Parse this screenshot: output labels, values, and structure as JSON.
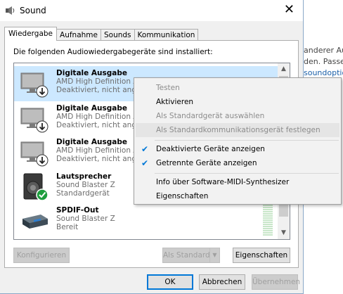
{
  "background_text": {
    "line1": "anderer Au",
    "line2": "den. Passe",
    "line3": "soundoptio"
  },
  "window": {
    "title": "Sound",
    "close_glyph": "✕",
    "icon": "speaker-icon"
  },
  "tabs": [
    {
      "label": "Wiedergabe",
      "active": true
    },
    {
      "label": "Aufnahme",
      "active": false
    },
    {
      "label": "Sounds",
      "active": false
    },
    {
      "label": "Kommunikation",
      "active": false
    }
  ],
  "intro_text": "Die folgenden Audiowiedergabegeräte sind installiert:",
  "devices": [
    {
      "name": "Digitale Ausgabe",
      "sub1": "AMD High Definition A",
      "sub2": "Deaktiviert, nicht anges",
      "icon": "monitor-disabled-icon",
      "selected": true
    },
    {
      "name": "Digitale Ausgabe",
      "sub1": "AMD High Definition A",
      "sub2": "Deaktiviert, nicht anges",
      "icon": "monitor-disabled-icon",
      "selected": false
    },
    {
      "name": "Digitale Ausgabe",
      "sub1": "AMD High Definition A",
      "sub2": "Deaktiviert, nicht anges",
      "icon": "monitor-disabled-icon",
      "selected": false
    },
    {
      "name": "Lautsprecher",
      "sub1": "Sound Blaster Z",
      "sub2": "Standardgerät",
      "icon": "speaker-default-icon",
      "selected": false
    },
    {
      "name": "SPDIF-Out",
      "sub1": "Sound Blaster Z",
      "sub2": "Bereit",
      "icon": "spdif-device-icon",
      "selected": false
    }
  ],
  "scroll": {
    "up": "▲",
    "down": "▼"
  },
  "buttons": {
    "configure": "Konfigurieren",
    "set_default": "Als Standard",
    "set_default_arrow": "▼",
    "properties": "Eigenschaften",
    "ok": "OK",
    "cancel": "Abbrechen",
    "apply": "Übernehmen"
  },
  "context_menu": {
    "check_glyph": "✔",
    "items": [
      {
        "label": "Testen",
        "disabled": true,
        "checked": false
      },
      {
        "label": "Aktivieren",
        "disabled": false,
        "checked": false
      },
      {
        "label": "Als Standardgerät auswählen",
        "disabled": true,
        "checked": false
      },
      {
        "label": "Als Standardkommunikationsgerät festlegen",
        "disabled": true,
        "checked": false,
        "hover": true
      },
      {
        "label": "Deaktivierte Geräte anzeigen",
        "disabled": false,
        "checked": true
      },
      {
        "label": "Getrennte Geräte anzeigen",
        "disabled": false,
        "checked": true
      },
      {
        "label": "Info über Software-MIDI-Synthesizer",
        "disabled": false,
        "checked": false
      },
      {
        "label": "Eigenschaften",
        "disabled": false,
        "checked": false
      }
    ]
  },
  "colors": {
    "selection": "#cce8ff",
    "accent": "#0078d7",
    "default_badge": "#1e9e3e"
  }
}
